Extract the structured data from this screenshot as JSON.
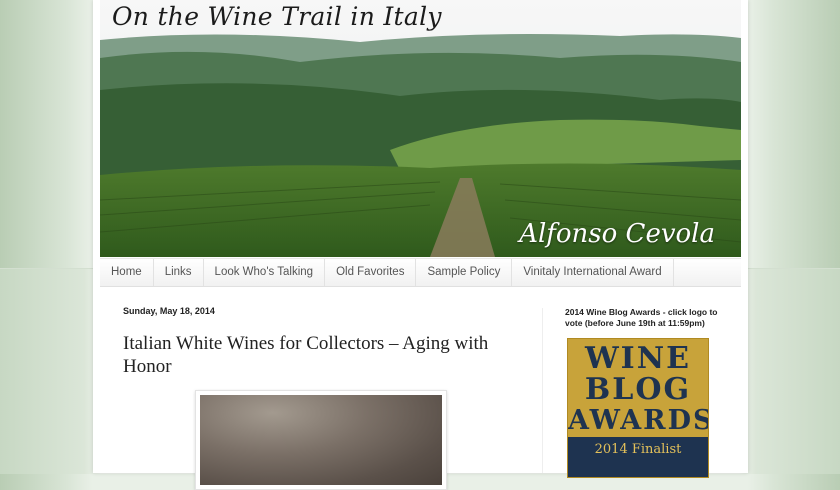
{
  "header": {
    "title": "On the Wine Trail in Italy",
    "author": "Alfonso Cevola"
  },
  "nav": {
    "items": [
      {
        "label": "Home"
      },
      {
        "label": "Links"
      },
      {
        "label": "Look Who's Talking"
      },
      {
        "label": "Old Favorites"
      },
      {
        "label": "Sample Policy"
      },
      {
        "label": "Vinitaly International Award"
      }
    ]
  },
  "post": {
    "date": "Sunday, May 18, 2014",
    "title": "Italian White Wines for Collectors – Aging with Honor"
  },
  "sidebar": {
    "heading": "2014 Wine Blog Awards - click logo to vote (before June 19th at 11:59pm)",
    "award": {
      "line1": "WINE",
      "line2": "BLOG",
      "line3": "AWARDS",
      "finalist": "2014 Finalist"
    }
  },
  "colors": {
    "background": "#e9f0e7",
    "award_gold": "#c8a33a",
    "award_navy": "#1e3350"
  }
}
